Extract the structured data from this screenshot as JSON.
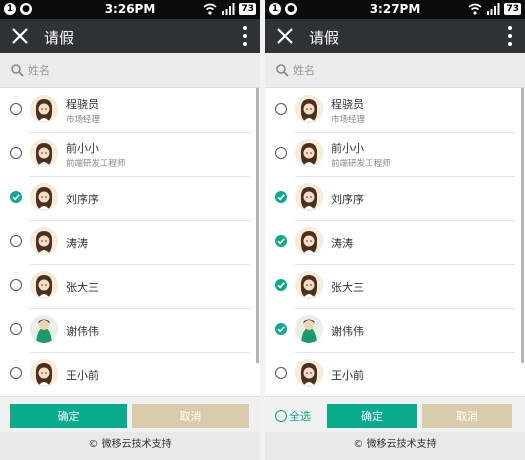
{
  "left": {
    "status": {
      "time": "3:26PM",
      "battery": "73"
    },
    "title": "请假",
    "search": {
      "placeholder": "姓名"
    },
    "contacts": [
      {
        "name": "程骁员",
        "subtitle": "市场经理",
        "checked": false,
        "avatar": "girl"
      },
      {
        "name": "前小小",
        "subtitle": "前端研发工程师",
        "checked": false,
        "avatar": "girl"
      },
      {
        "name": "刘序序",
        "subtitle": "",
        "checked": true,
        "avatar": "girl"
      },
      {
        "name": "涛涛",
        "subtitle": "",
        "checked": false,
        "avatar": "girl"
      },
      {
        "name": "张大三",
        "subtitle": "",
        "checked": false,
        "avatar": "girl"
      },
      {
        "name": "谢伟伟",
        "subtitle": "",
        "checked": false,
        "avatar": "green"
      },
      {
        "name": "王小前",
        "subtitle": "",
        "checked": false,
        "avatar": "girl"
      }
    ],
    "buttons": {
      "ok": "确定",
      "cancel": "取消"
    },
    "footer": "© 微移云技术支持"
  },
  "right": {
    "status": {
      "time": "3:27PM",
      "battery": "73"
    },
    "title": "请假",
    "search": {
      "placeholder": "姓名"
    },
    "contacts": [
      {
        "name": "程骁员",
        "subtitle": "市场经理",
        "checked": false,
        "avatar": "girl"
      },
      {
        "name": "前小小",
        "subtitle": "前端研发工程师",
        "checked": false,
        "avatar": "girl"
      },
      {
        "name": "刘序序",
        "subtitle": "",
        "checked": true,
        "avatar": "girl"
      },
      {
        "name": "涛涛",
        "subtitle": "",
        "checked": true,
        "avatar": "girl"
      },
      {
        "name": "张大三",
        "subtitle": "",
        "checked": true,
        "avatar": "girl"
      },
      {
        "name": "谢伟伟",
        "subtitle": "",
        "checked": true,
        "avatar": "green"
      },
      {
        "name": "王小前",
        "subtitle": "",
        "checked": false,
        "avatar": "girl"
      }
    ],
    "select_all": "全选",
    "buttons": {
      "ok": "确定",
      "cancel": "取消"
    },
    "footer": "© 微移云技术支持"
  },
  "colors": {
    "accent": "#0aab8c",
    "cancel": "#d8ccad",
    "titlebar": "#2d3237"
  },
  "icons": {
    "close": "close-icon",
    "more": "more-vertical-icon",
    "search": "search-icon",
    "check": "check-icon"
  }
}
